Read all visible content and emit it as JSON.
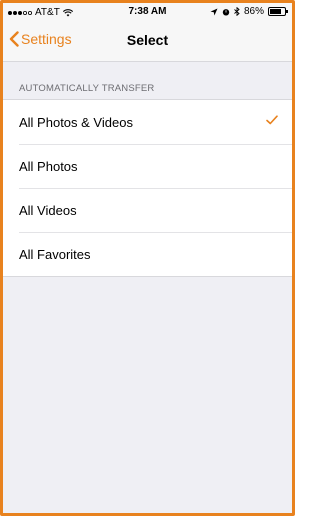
{
  "status_bar": {
    "carrier": "AT&T",
    "time": "7:38 AM",
    "battery": "86%"
  },
  "nav": {
    "back_label": "Settings",
    "title": "Select"
  },
  "section": {
    "header": "AUTOMATICALLY TRANSFER"
  },
  "options": [
    {
      "label": "All Photos & Videos",
      "selected": true
    },
    {
      "label": "All Photos",
      "selected": false
    },
    {
      "label": "All Videos",
      "selected": false
    },
    {
      "label": "All Favorites",
      "selected": false
    }
  ],
  "colors": {
    "accent": "#e8821e",
    "background": "#efeff4",
    "cell": "#ffffff",
    "header_text": "#6d6d72"
  }
}
